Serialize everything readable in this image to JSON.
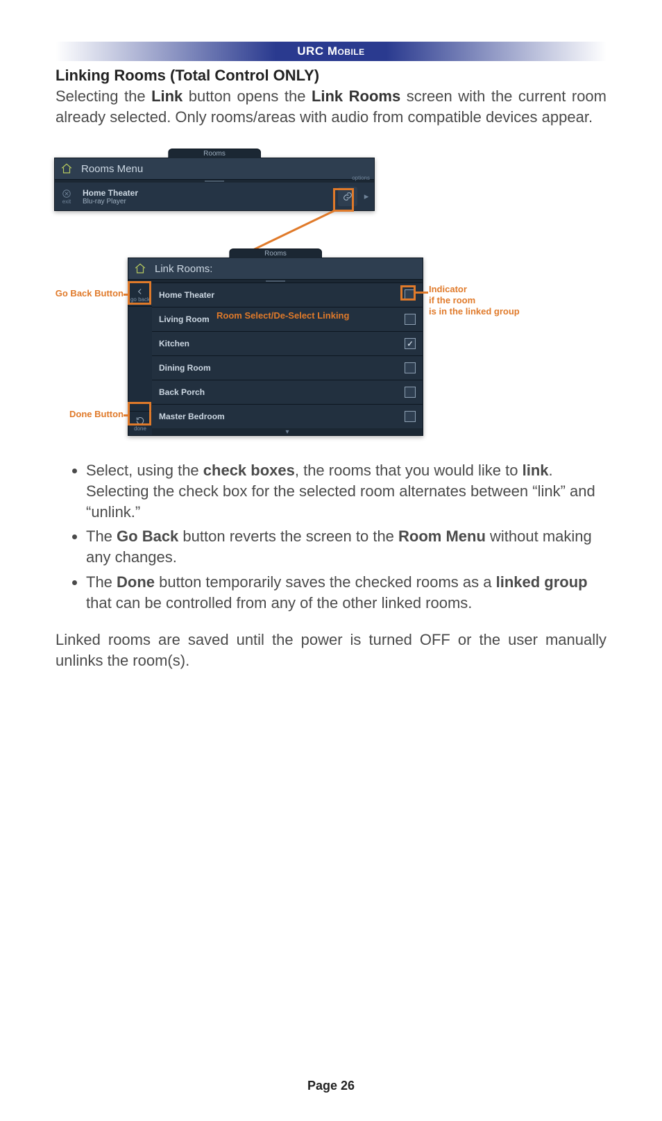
{
  "header": {
    "app": "URC",
    "app2": "Mobile"
  },
  "title": "Linking Rooms (Total Control ONLY)",
  "intro": {
    "pre": "Selecting the ",
    "b1": "Link",
    "mid": " button opens the ",
    "b2": "Link Rooms",
    "post": " screen with the current room already selected. Only rooms/areas with audio from compatible devices appear."
  },
  "panel1": {
    "tab": "Rooms",
    "title": "Rooms Menu",
    "exit": "exit",
    "device": "Home Theater",
    "sub": "Blu-ray Player",
    "options": "options"
  },
  "panel2": {
    "tab": "Rooms",
    "title": "Link Rooms:",
    "goback": "go back",
    "done": "done",
    "rooms": [
      {
        "name": "Home Theater",
        "checked": false,
        "hl": true
      },
      {
        "name": "Living Room",
        "checked": false
      },
      {
        "name": "Kitchen",
        "checked": true
      },
      {
        "name": "Dining Room",
        "checked": false
      },
      {
        "name": "Back Porch",
        "checked": false
      },
      {
        "name": "Master Bedroom",
        "checked": false
      }
    ]
  },
  "ann": {
    "goback": "Go Back Button",
    "done": "Done Button",
    "roomsel": "Room Select/De-Select Linking",
    "ind1": "Indicator",
    "ind2": "if the room",
    "ind3": "is in the linked group"
  },
  "bullets": {
    "b1a": "Select, using the ",
    "b1b": "check boxes",
    "b1c": ", the rooms that you would like to ",
    "b1d": "link",
    "b1e": ". Selecting the check box for the selected room alternates between “link” and “unlink.”",
    "b2a": "The ",
    "b2b": "Go Back",
    "b2c": " button reverts the screen to the ",
    "b2d": "Room Menu",
    "b2e": " without making any changes.",
    "b3a": "The ",
    "b3b": "Done",
    "b3c": " button temporarily saves the checked rooms as a ",
    "b3d": "linked group",
    "b3e": " that can be controlled from any of the other linked rooms."
  },
  "closing": "Linked rooms are saved until the power is turned OFF or the user manually unlinks the room(s).",
  "footer": "Page 26"
}
